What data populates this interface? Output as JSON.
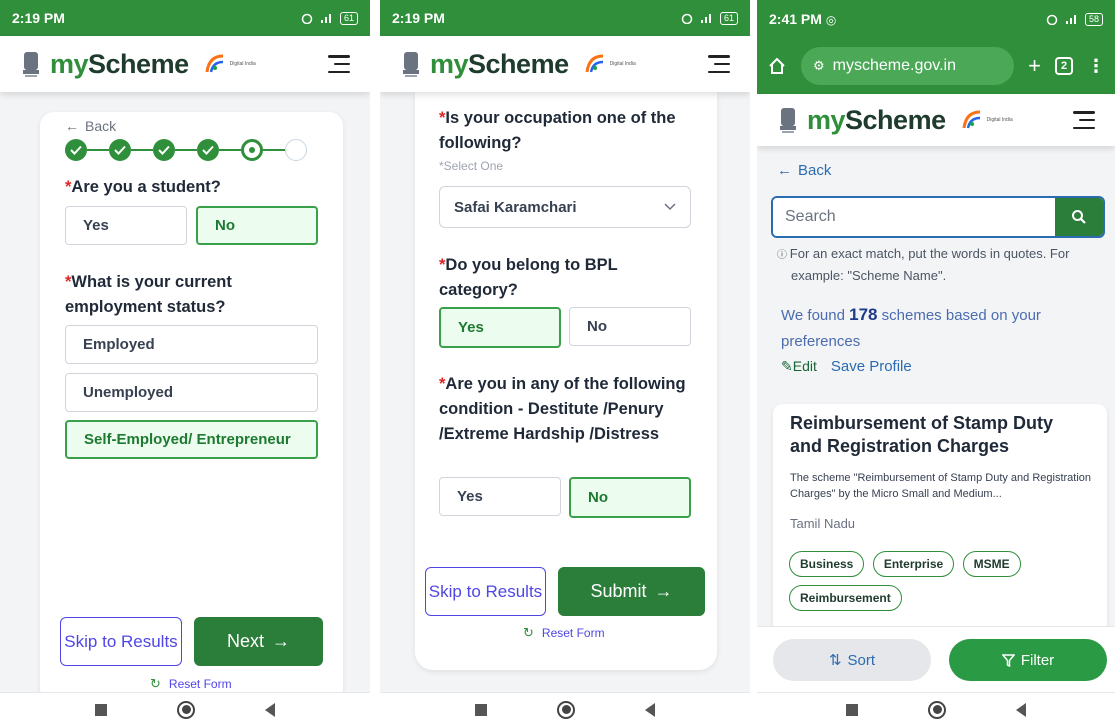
{
  "phone1": {
    "time": "2:19 PM",
    "battery": "61",
    "brand": {
      "my": "my",
      "scheme": "Scheme"
    },
    "back_label": "Back",
    "question1": "Are you a student?",
    "q1_options": [
      "Yes",
      "No"
    ],
    "question2": "What is your current employment status?",
    "q2_options": [
      "Employed",
      "Unemployed",
      "Self-Employed/ Entrepreneur"
    ],
    "skip_label": "Skip to Results",
    "next_label": "Next",
    "reset_label": "Reset Form"
  },
  "phone2": {
    "time": "2:19 PM",
    "battery": "61",
    "brand": {
      "my": "my",
      "scheme": "Scheme"
    },
    "question1": "Is your occupation one of the following?",
    "q1_hint": "*Select One",
    "q1_selected": "Safai Karamchari",
    "question2": "Do you belong to BPL category?",
    "q2_options": [
      "Yes",
      "No"
    ],
    "question3": "Are you in any of the following condition - Destitute /Penury /Extreme Hardship /Distress",
    "q3_options": [
      "Yes",
      "No"
    ],
    "skip_label": "Skip to Results",
    "submit_label": "Submit",
    "reset_label": "Reset Form"
  },
  "phone3": {
    "time": "2:41 PM",
    "battery": "58",
    "url": "myscheme.gov.in",
    "tab_count": "2",
    "brand": {
      "my": "my",
      "scheme": "Scheme"
    },
    "back_label": "Back",
    "search_placeholder": "Search",
    "search_hint": "For an exact match, put the words in quotes. For example: \"Scheme Name\".",
    "found_prefix": "We found",
    "found_count": "178",
    "found_suffix": "schemes based on your preferences",
    "edit_label": "Edit",
    "save_profile_label": "Save Profile",
    "scheme_title": "Reimbursement of Stamp Duty and Registration Charges",
    "scheme_desc": "The scheme \"Reimbursement of Stamp Duty and Registration Charges\" by the Micro Small and Medium...",
    "scheme_state": "Tamil Nadu",
    "tags": [
      "Business",
      "Enterprise",
      "MSME",
      "Reimbursement"
    ],
    "sort_label": "Sort",
    "filter_label": "Filter"
  },
  "digital_india_text": "Digital India"
}
